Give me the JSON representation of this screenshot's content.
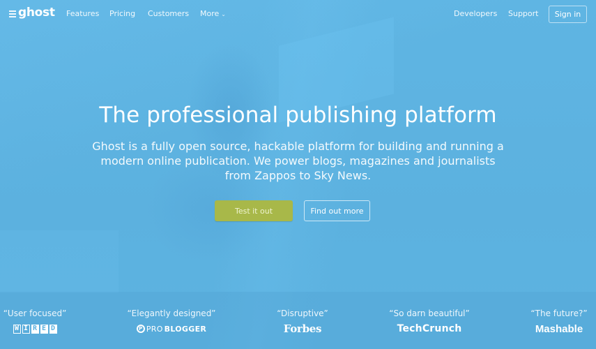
{
  "nav": {
    "logo": "ghost",
    "links": [
      {
        "label": "Features"
      },
      {
        "label": "Pricing"
      },
      {
        "label": "Customers"
      },
      {
        "label": "More",
        "icon": "chevron-down-icon",
        "glyph": "⌄"
      }
    ],
    "right_links": [
      {
        "label": "Developers"
      },
      {
        "label": "Support"
      }
    ],
    "signin_label": "Sign in"
  },
  "hero": {
    "title": "The professional publishing platform",
    "description": "Ghost is a fully open source, hackable platform for building and running a modern online publication. We power blogs, magazines and journalists from Zappos to Sky News.",
    "primary_button": "Test it out",
    "secondary_button": "Find out more"
  },
  "colors": {
    "background": "#5db2e0",
    "primary_button": "#a8b849"
  },
  "testimonials": [
    {
      "quote": "“User focused”",
      "brand": "WIRED",
      "brand_letters": [
        "W",
        "I",
        "R",
        "E",
        "D"
      ]
    },
    {
      "quote": "“Elegantly designed”",
      "brand": "ProBlogger",
      "brand_parts": {
        "icon": "P",
        "pro": "PRO",
        "blogger": "BLOGGER"
      }
    },
    {
      "quote": "“Disruptive”",
      "brand": "Forbes"
    },
    {
      "quote": "“So darn beautiful”",
      "brand": "TechCrunch"
    },
    {
      "quote": "“The future?”",
      "brand": "Mashable"
    }
  ]
}
